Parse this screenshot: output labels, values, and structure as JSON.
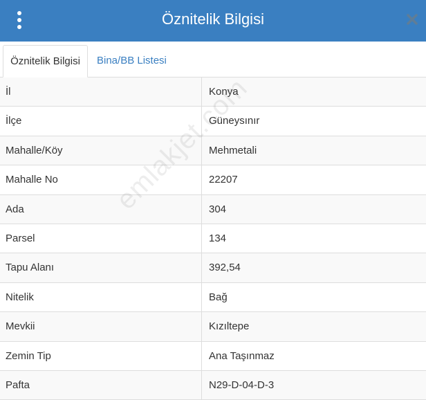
{
  "header": {
    "title": "Öznitelik Bilgisi",
    "background": "#3a7fc1"
  },
  "tabs": [
    {
      "label": "Öznitelik Bilgisi",
      "active": true
    },
    {
      "label": "Bina/BB Listesi",
      "active": false
    }
  ],
  "attributes": [
    {
      "label": "İl",
      "value": "Konya"
    },
    {
      "label": "İlçe",
      "value": "Güneysınır"
    },
    {
      "label": "Mahalle/Köy",
      "value": "Mehmetali"
    },
    {
      "label": "Mahalle No",
      "value": "22207"
    },
    {
      "label": "Ada",
      "value": "304"
    },
    {
      "label": "Parsel",
      "value": "134"
    },
    {
      "label": "Tapu Alanı",
      "value": "392,54"
    },
    {
      "label": "Nitelik",
      "value": "Bağ"
    },
    {
      "label": "Mevkii",
      "value": "Kızıltepe"
    },
    {
      "label": "Zemin Tip",
      "value": "Ana Taşınmaz"
    },
    {
      "label": "Pafta",
      "value": "N29-D-04-D-3"
    }
  ],
  "watermark": "emlakjet.com",
  "icons": {
    "menu": "vertical-dots-icon",
    "close": "close-icon"
  }
}
